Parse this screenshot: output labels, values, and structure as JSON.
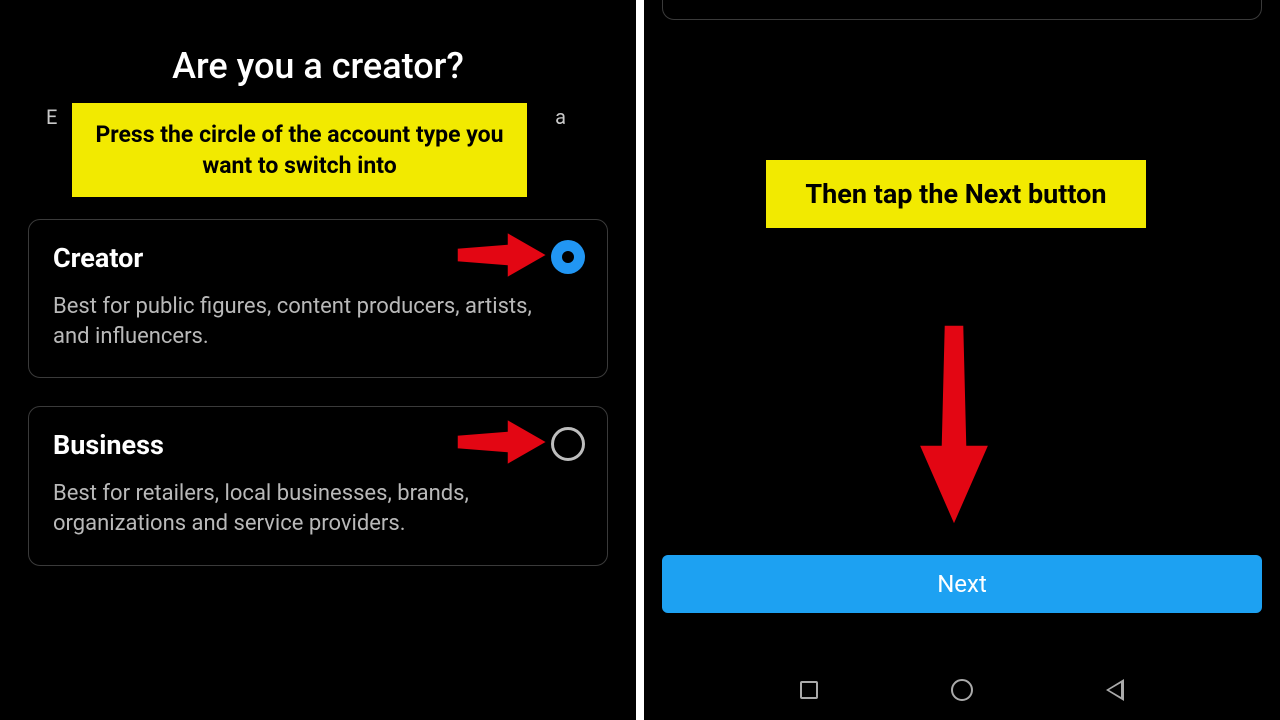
{
  "left": {
    "heading": "Are you a creator?",
    "subtext_left_char": "E",
    "subtext_right_char": "a",
    "callout": "Press the circle of the account type you want to switch into",
    "options": [
      {
        "title": "Creator",
        "desc": "Best for public figures, content producers, artists, and influencers.",
        "selected": true
      },
      {
        "title": "Business",
        "desc": "Best for retailers, local businesses, brands, organizations and service providers.",
        "selected": false
      }
    ]
  },
  "right": {
    "callout": "Then tap the Next button",
    "next_label": "Next"
  }
}
